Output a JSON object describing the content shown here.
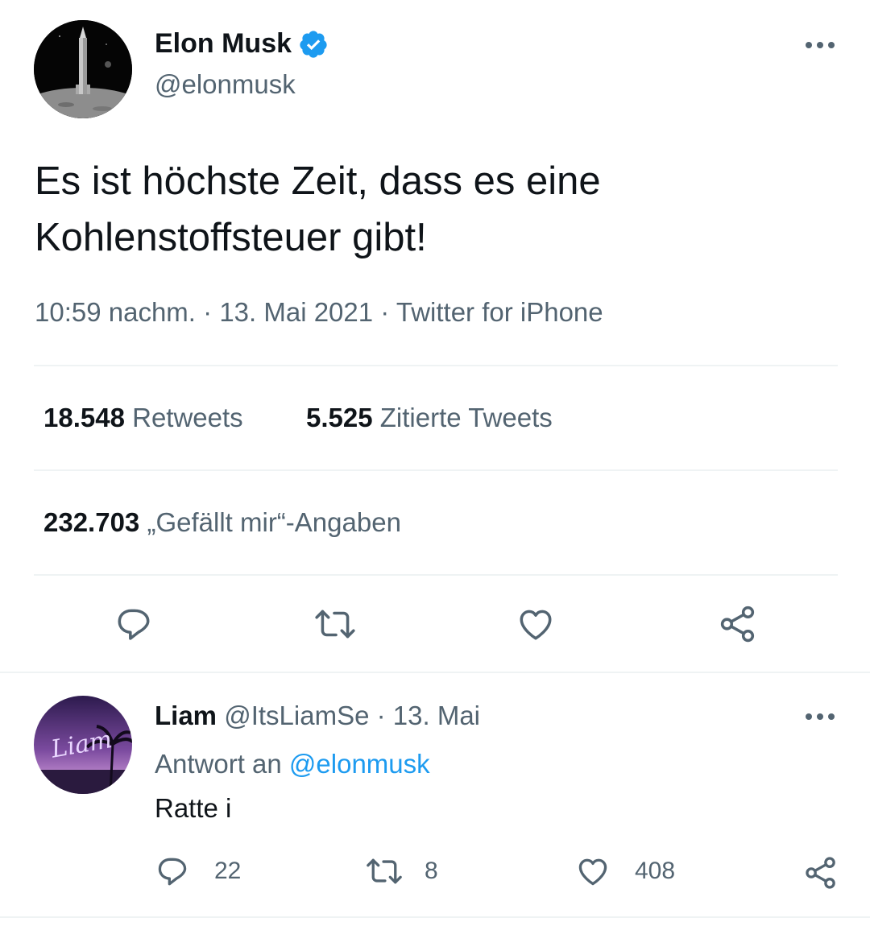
{
  "tweet": {
    "author_name": "Elon Musk",
    "author_handle": "@elonmusk",
    "text_line1": "Es ist höchste Zeit, dass es eine",
    "text_line2": "Kohlenstoffsteuer gibt!",
    "time": "10:59 nachm.",
    "date": "13. Mai 2021",
    "source": "Twitter for iPhone",
    "retweets_count": "18.548",
    "retweets_label": "Retweets",
    "quotes_count": "5.525",
    "quotes_label": "Zitierte Tweets",
    "likes_count": "232.703",
    "likes_label": "„Gefällt mir“-Angaben",
    "verified": true
  },
  "reply": {
    "author_name": "Liam",
    "author_handle": "@ItsLiamSe",
    "date": "13. Mai",
    "replying_to_prefix": "Antwort an",
    "replying_to_handle": "@elonmusk",
    "text": "Ratte i",
    "reply_count": "22",
    "retweet_count": "8",
    "like_count": "408",
    "avatar_text": "Liam"
  },
  "colors": {
    "text": "#0f1419",
    "secondary": "#536471",
    "link": "#1d9bf0",
    "divider": "#eff3f4"
  },
  "icons": [
    "verified-badge-icon",
    "more-icon",
    "reply-icon",
    "retweet-icon",
    "like-icon",
    "share-icon"
  ]
}
